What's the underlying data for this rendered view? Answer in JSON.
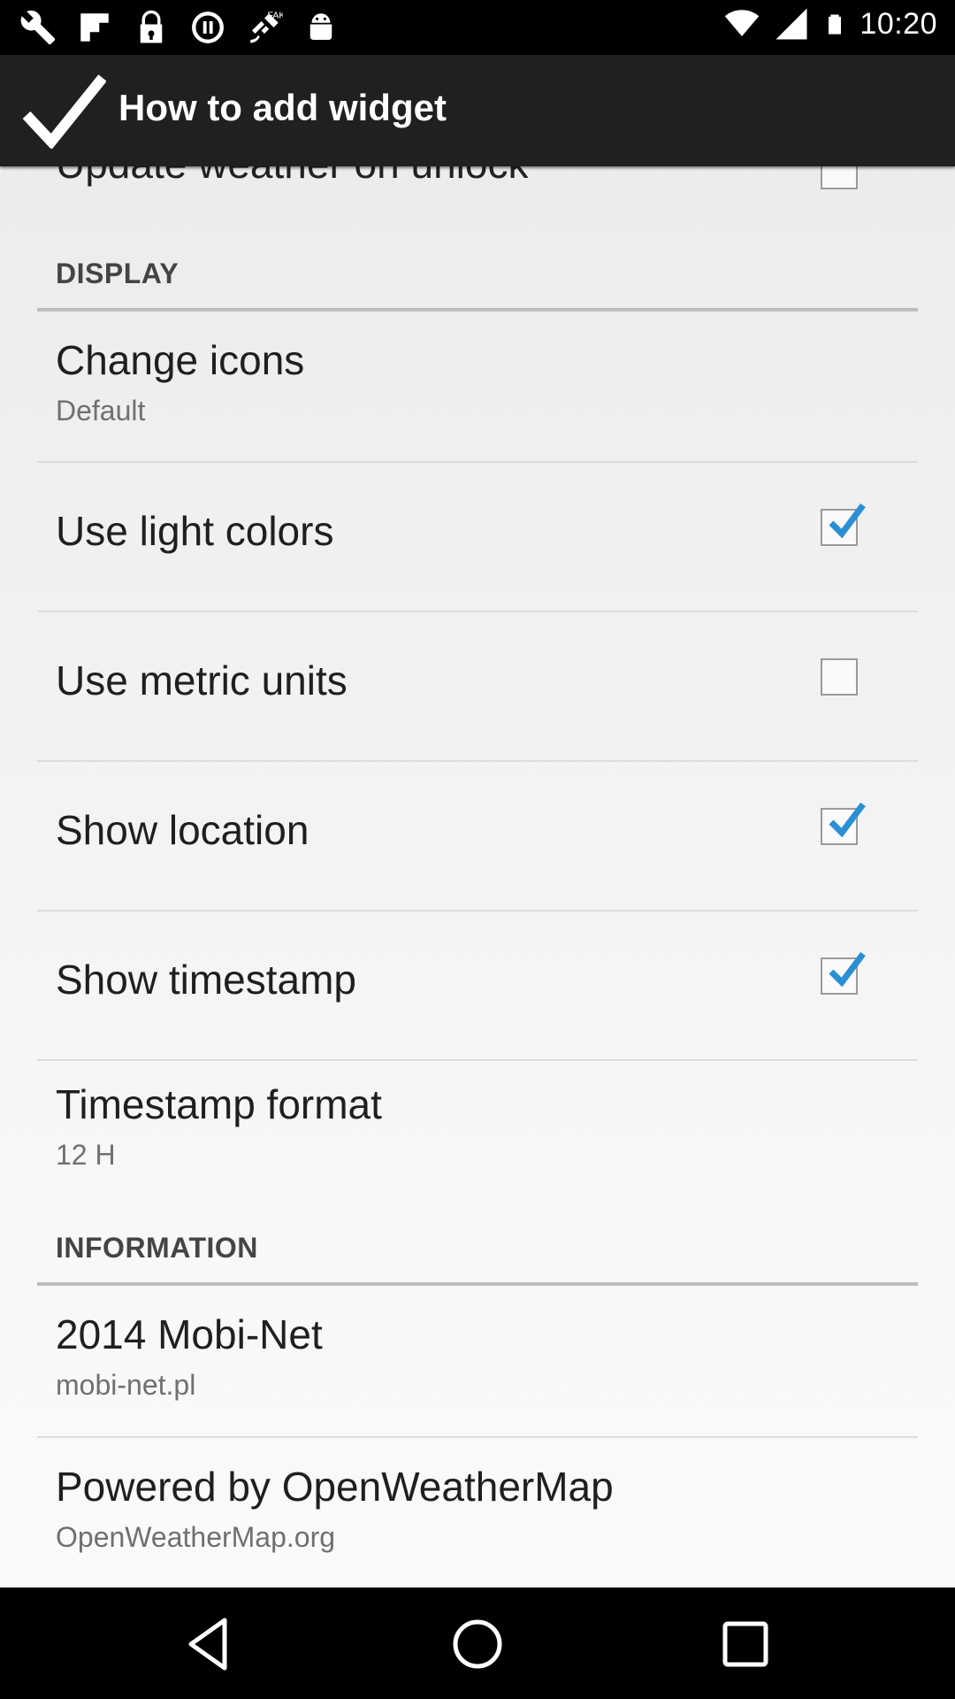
{
  "status_bar": {
    "time": "10:20",
    "icons": [
      "wrench-icon",
      "flipboard-icon",
      "lock-icon",
      "media-icon",
      "fake-gps-icon",
      "android-icon",
      "wifi-icon",
      "signal-icon",
      "battery-icon"
    ]
  },
  "app_bar": {
    "title": "How to add widget",
    "icon": "check-icon"
  },
  "partial_row": {
    "title": "Update weather on unlock",
    "checked": false
  },
  "sections": {
    "display": "DISPLAY",
    "information": "INFORMATION"
  },
  "rows": {
    "change_icons": {
      "title": "Change icons",
      "summary": "Default"
    },
    "use_light_colors": {
      "title": "Use light colors",
      "checked": true
    },
    "use_metric_units": {
      "title": "Use metric units",
      "checked": false
    },
    "show_location": {
      "title": "Show location",
      "checked": true
    },
    "show_timestamp": {
      "title": "Show timestamp",
      "checked": true
    },
    "timestamp_format": {
      "title": "Timestamp format",
      "summary": "12 H"
    },
    "mobi_net": {
      "title": "2014 Mobi-Net",
      "summary": "mobi-net.pl"
    },
    "powered_by": {
      "title": "Powered by OpenWeatherMap",
      "summary": "OpenWeatherMap.org"
    }
  },
  "nav_bar": {
    "icons": [
      "back-icon",
      "home-icon",
      "recents-icon"
    ]
  },
  "colors": {
    "check_accent": "#2a8fd4",
    "app_bar": "#202020",
    "background": "#f5f5f5"
  }
}
